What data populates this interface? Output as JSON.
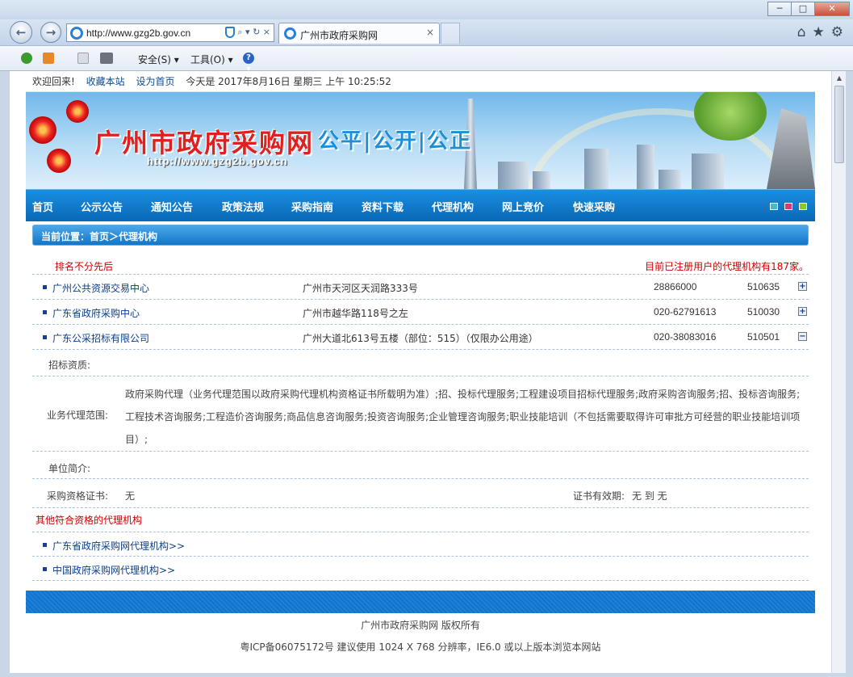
{
  "browser": {
    "url": "http://www.gzg2b.gov.cn",
    "tab_title": "广州市政府采购网",
    "tab_close": "×",
    "back_glyph": "←",
    "forward_glyph": "→",
    "addr_tools": "⌕ ▾ ↻ ×",
    "window_controls": {
      "minimize": "─",
      "maximize": "□",
      "close": "✕"
    },
    "right_icons": {
      "home": "⌂",
      "favorites": "★",
      "tools": "⚙"
    },
    "commands": {
      "safety": "安全(S) ▾",
      "tools": "工具(O) ▾",
      "help": "? ▾"
    }
  },
  "topline": {
    "welcome": "欢迎回来!",
    "bookmark": "收藏本站",
    "set_home": "设为首页",
    "date_text": "今天是 2017年8月16日 星期三 上午 10:25:52"
  },
  "banner": {
    "title": "广州市政府采购网",
    "url": "http://www.gzg2b.gov.cn",
    "slogan": "公平|公开|公正"
  },
  "nav": {
    "items": [
      "首页",
      "公示公告",
      "通知公告",
      "政策法规",
      "采购指南",
      "资料下载",
      "代理机构",
      "网上竞价",
      "快速采购"
    ]
  },
  "breadcrumb": "当前位置：首页＞代理机构",
  "list": {
    "rank_note": "排名不分先后",
    "count_note": "目前已注册用户的代理机构有187家。",
    "agencies": [
      {
        "name": "广州公共资源交易中心",
        "address": "广州市天河区天润路333号",
        "phone": "28866000",
        "zip": "510635",
        "toggle": "+"
      },
      {
        "name": "广东省政府采购中心",
        "address": "广州市越华路118号之左",
        "phone": "020-62791613",
        "zip": "510030",
        "toggle": "+"
      },
      {
        "name": "广东公采招标有限公司",
        "address": "广州大道北613号五楼（部位：515）（仅限办公用途）",
        "phone": "020-38083016",
        "zip": "510501",
        "toggle": "−"
      }
    ]
  },
  "detail": {
    "qualification_label": "招标资质:",
    "scope_label": "业务代理范围:",
    "scope_value": "政府采购代理（业务代理范围以政府采购代理机构资格证书所载明为准）;招、投标代理服务;工程建设项目招标代理服务;政府采购咨询服务;招、投标咨询服务;工程技术咨询服务;工程造价咨询服务;商品信息咨询服务;投资咨询服务;企业管理咨询服务;职业技能培训（不包括需要取得许可审批方可经营的职业技能培训项目）;",
    "intro_label": "单位简介:",
    "cert_label": "采购资格证书:",
    "cert_value": "无",
    "validity_label": "证书有效期:",
    "validity_value": "无 到 无"
  },
  "others": {
    "heading": "其他符合资格的代理机构",
    "links": [
      "广东省政府采购网代理机构>>",
      "中国政府采购网代理机构>>"
    ]
  },
  "footer": {
    "copyright": "广州市政府采购网 版权所有",
    "icp": "粤ICP备06075172号 建议使用 1024 X 768 分辨率，IE6.0 或以上版本浏览本网站"
  },
  "colors": {
    "nav_blue": "#0a68b6",
    "title_red": "#e0201e",
    "note_red": "#cc0000",
    "link_blue": "#0b3f8c",
    "nav_squares": [
      "#4ab8c9",
      "#e8356e",
      "#8ccb1e"
    ]
  },
  "icons": [
    "ie-icon",
    "shield-icon",
    "search-icon",
    "refresh-icon",
    "home-icon",
    "star-icon",
    "gear-icon",
    "rss-icon",
    "mail-icon",
    "print-icon",
    "help-icon"
  ]
}
